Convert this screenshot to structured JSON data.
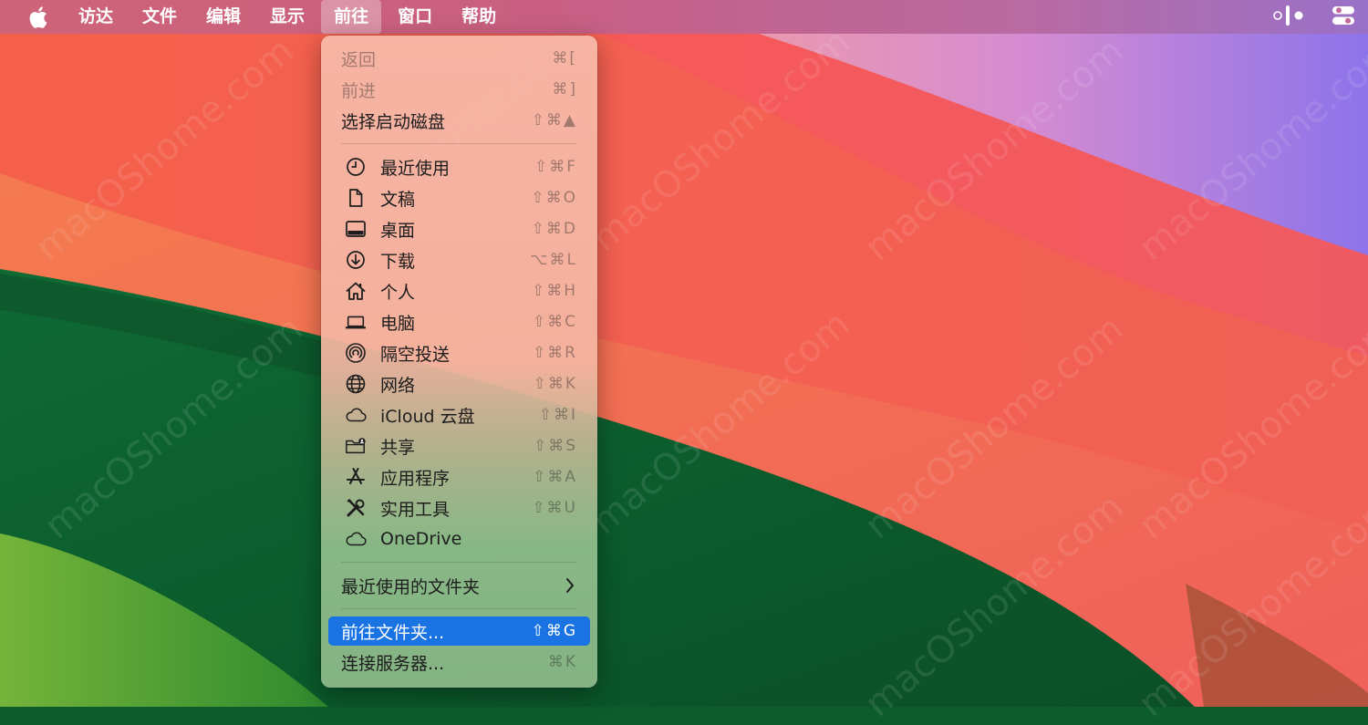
{
  "menubar": {
    "items": [
      "访达",
      "文件",
      "编辑",
      "显示",
      "前往",
      "窗口",
      "帮助"
    ],
    "active_index": 4
  },
  "menu": {
    "title": "前往",
    "items": {
      "back": {
        "label": "返回",
        "shortcut": "⌘[",
        "icon": null
      },
      "forward": {
        "label": "前进",
        "shortcut": "⌘]",
        "icon": null
      },
      "startup_disk": {
        "label": "选择启动磁盘",
        "shortcut": "⇧⌘▲",
        "icon": null
      },
      "recents": {
        "label": "最近使用",
        "shortcut": "⇧⌘F",
        "icon": "clock-icon"
      },
      "documents": {
        "label": "文稿",
        "shortcut": "⇧⌘O",
        "icon": "document-icon"
      },
      "desktop": {
        "label": "桌面",
        "shortcut": "⇧⌘D",
        "icon": "desktop-icon"
      },
      "downloads": {
        "label": "下载",
        "shortcut": "⌥⌘L",
        "icon": "download-icon"
      },
      "home": {
        "label": "个人",
        "shortcut": "⇧⌘H",
        "icon": "house-icon"
      },
      "computer": {
        "label": "电脑",
        "shortcut": "⇧⌘C",
        "icon": "laptop-icon"
      },
      "airdrop": {
        "label": "隔空投送",
        "shortcut": "⇧⌘R",
        "icon": "airdrop-icon"
      },
      "network": {
        "label": "网络",
        "shortcut": "⇧⌘K",
        "icon": "globe-icon"
      },
      "icloud": {
        "label": "iCloud 云盘",
        "shortcut": "⇧⌘I",
        "icon": "cloud-icon"
      },
      "shared": {
        "label": "共享",
        "shortcut": "⇧⌘S",
        "icon": "shared-folder-icon"
      },
      "applications": {
        "label": "应用程序",
        "shortcut": "⇧⌘A",
        "icon": "app-store-icon"
      },
      "utilities": {
        "label": "实用工具",
        "shortcut": "⇧⌘U",
        "icon": "tools-icon"
      },
      "onedrive": {
        "label": "OneDrive",
        "shortcut": "",
        "icon": "cloud-icon"
      },
      "recent_folders": {
        "label": "最近使用的文件夹",
        "shortcut": "",
        "icon": "chevron-right-icon"
      },
      "goto_folder": {
        "label": "前往文件夹...",
        "shortcut": "⇧⌘G",
        "icon": null
      },
      "connect_server": {
        "label": "连接服务器...",
        "shortcut": "⌘K",
        "icon": null
      }
    },
    "selected": "goto_folder",
    "disabled": [
      "back",
      "forward"
    ]
  },
  "watermark": "macOShome.com",
  "colors": {
    "menubar": "#c85f82",
    "selection": "#1a73e2",
    "wallpaper_red": "#f25a55",
    "wallpaper_green": "#0f6a34"
  }
}
